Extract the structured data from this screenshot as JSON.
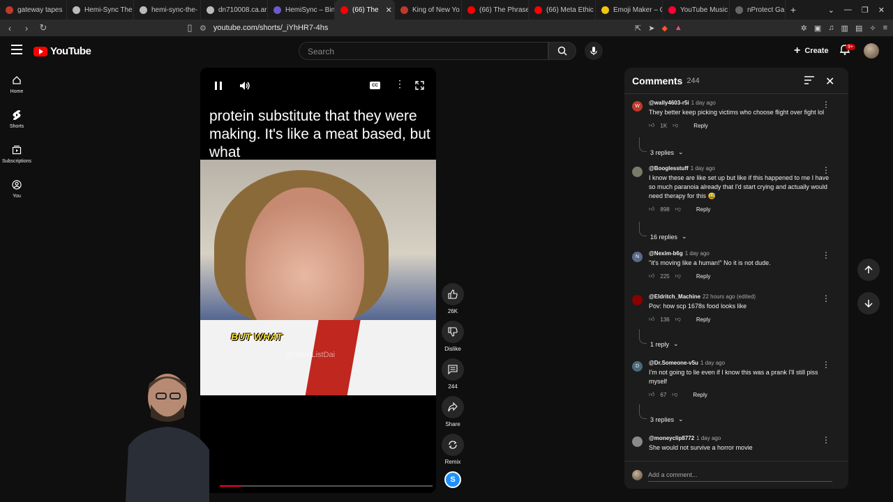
{
  "browser": {
    "tabs": [
      {
        "label": "gateway tapes",
        "color": "#c0392b",
        "active": false
      },
      {
        "label": "Hemi-Sync The",
        "color": "#bbbbbb",
        "active": false
      },
      {
        "label": "hemi-sync-the-",
        "color": "#bbbbbb",
        "active": false
      },
      {
        "label": "dn710008.ca.ar",
        "color": "#bbbbbb",
        "active": false
      },
      {
        "label": "HemiSync – Bin",
        "color": "#6a5acd",
        "active": false
      },
      {
        "label": "(66) The",
        "color": "#ff0000",
        "active": true
      },
      {
        "label": "King of New Yo",
        "color": "#c0392b",
        "active": false
      },
      {
        "label": "(66) The Phrase",
        "color": "#ff0000",
        "active": false
      },
      {
        "label": "(66) Meta Ethic",
        "color": "#ff0000",
        "active": false
      },
      {
        "label": "Emoji Maker – C",
        "color": "#f1c40f",
        "active": false
      },
      {
        "label": "YouTube Music",
        "color": "#ff0033",
        "active": false
      },
      {
        "label": "nProtect Game",
        "color": "#666666",
        "active": false
      }
    ],
    "url": "youtube.com/shorts/_iYhHR7-4hs"
  },
  "header": {
    "logo_text": "YouTube",
    "search_placeholder": "Search",
    "create_label": "Create",
    "notification_badge": "9+"
  },
  "sidenav": [
    {
      "label": "Home",
      "icon": "home-icon"
    },
    {
      "label": "Shorts",
      "icon": "shorts-icon"
    },
    {
      "label": "Subscriptions",
      "icon": "subscriptions-icon"
    },
    {
      "label": "You",
      "icon": "you-icon"
    }
  ],
  "video": {
    "caption": "protein substitute that they were making. It's like a meat based, but what",
    "burned_subtitle": "BUT WHAT",
    "watermark": "@ShortListDai",
    "progress": 0.1
  },
  "actions": {
    "likes": "26K",
    "dislike": "Dislike",
    "comments": "244",
    "share": "Share",
    "remix": "Remix"
  },
  "comments": {
    "title": "Comments",
    "count": "244",
    "input_placeholder": "Add a comment...",
    "items": [
      {
        "user": "@wally4603-r5i",
        "time": "1 day ago",
        "text": "They better keep picking victims who choose flight over fight lol",
        "likes": "1K",
        "replies": "3 replies",
        "avatar_letter": "W",
        "avatar_color": "#c0392b"
      },
      {
        "user": "@Booglesstuff",
        "time": "1 day ago",
        "text": "I know these are like set up but like if this happened to me I have so much paranoia already that I'd start crying and actually would need therapy for this 😅",
        "likes": "898",
        "replies": "16 replies",
        "avatar_letter": "",
        "avatar_color": "#7a7a6a"
      },
      {
        "user": "@Nexim-b6g",
        "time": "1 day ago",
        "text": "\"it's moving like a human!\" No it is not dude.",
        "likes": "225",
        "replies": "",
        "avatar_letter": "N",
        "avatar_color": "#5a6a8a"
      },
      {
        "user": "@Eldritch_Machine",
        "time": "22 hours ago (edited)",
        "text": "Pov: how scp 1678s food looks like",
        "likes": "136",
        "replies": "1 reply",
        "avatar_letter": "",
        "avatar_color": "#8b0000"
      },
      {
        "user": "@Dr.Someone-v5u",
        "time": "1 day ago",
        "text": "I'm not going to lie even if I know this was a prank I'll still piss myself",
        "likes": "67",
        "replies": "3 replies",
        "avatar_letter": "D",
        "avatar_color": "#4a6a7a"
      },
      {
        "user": "@moneyclip8772",
        "time": "1 day ago",
        "text": "She would not survive a horror movie",
        "likes": "",
        "replies": "",
        "avatar_letter": "",
        "avatar_color": "#8a8a8a"
      }
    ],
    "reply_label": "Reply"
  }
}
